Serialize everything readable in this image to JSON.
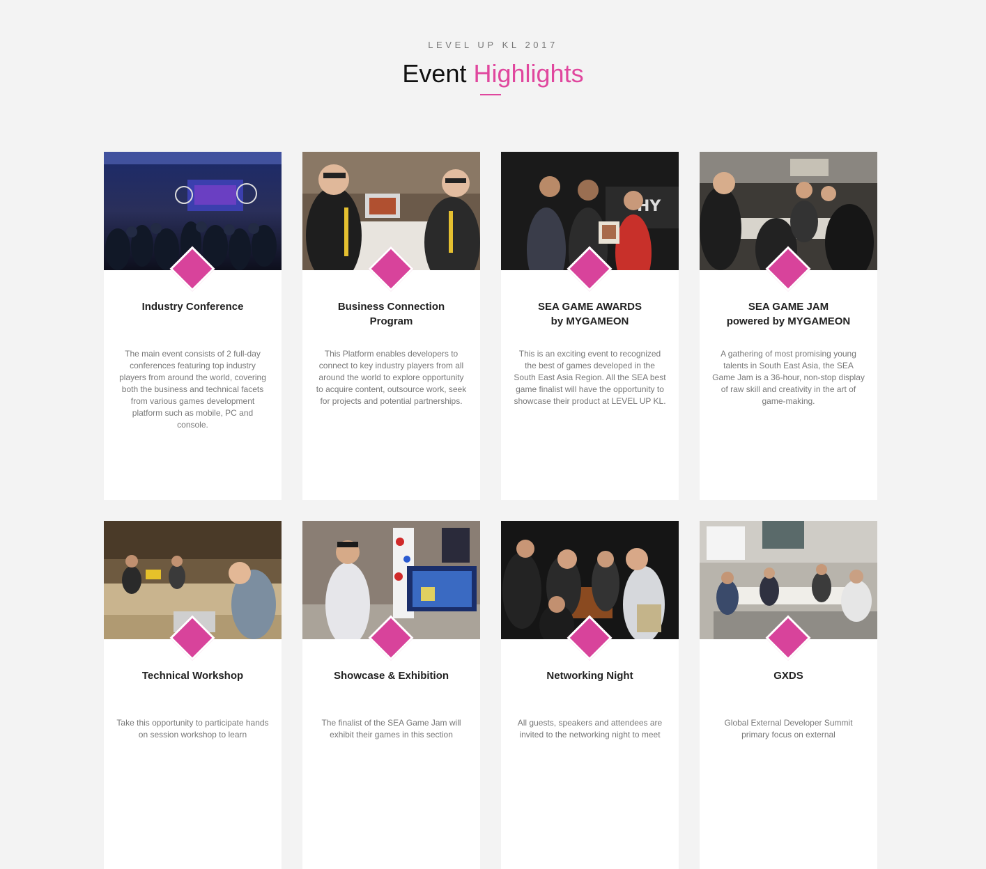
{
  "header": {
    "eyebrow": "LEVEL UP KL 2017",
    "title_part1": "Event",
    "title_part2": "Highlights"
  },
  "colors": {
    "accent": "#e0479e",
    "diamond": "#d8439b",
    "background": "#f3f3f3"
  },
  "cards": [
    {
      "title_line1": "Industry Conference",
      "title_line2": "",
      "description": "The main event consists of 2 full-day conferences featuring top industry players from around the world, covering both the business and technical facets from various games development platform such as mobile, PC and console.",
      "photo": "conference-hall-photo"
    },
    {
      "title_line1": "Business Connection",
      "title_line2": "Program",
      "description": "This Platform enables developers to connect to key industry players from all around the world to explore opportunity to acquire content, outsource work, seek for projects and potential partnerships.",
      "photo": "business-meeting-photo"
    },
    {
      "title_line1": "SEA GAME AWARDS",
      "title_line2": "by MYGAMEON",
      "description": "This is an exciting event to recognized the best of games developed in the South East Asia Region. All the SEA best game finalist will have the opportunity to showcase their product at LEVEL UP KL.",
      "photo": "award-ceremony-photo"
    },
    {
      "title_line1": "SEA GAME JAM",
      "title_line2": "powered by MYGAMEON",
      "description": "A gathering of most promising young talents in South East Asia, the SEA Game Jam is a 36-hour, non-stop display of raw skill and creativity in the art of game-making.",
      "photo": "game-jam-photo"
    },
    {
      "title_line1": "Technical Workshop",
      "title_line2": "",
      "description": "Take this opportunity to participate hands on session workshop to learn",
      "photo": "workshop-photo"
    },
    {
      "title_line1": "Showcase & Exhibition",
      "title_line2": "",
      "description": "The finalist of the SEA Game Jam will exhibit their games in this section",
      "photo": "exhibition-photo"
    },
    {
      "title_line1": "Networking Night",
      "title_line2": "",
      "description": "All guests, speakers and attendees are invited to the networking night to meet",
      "photo": "networking-party-photo"
    },
    {
      "title_line1": "GXDS",
      "title_line2": "",
      "description": "Global External Developer Summit primary focus on external",
      "photo": "summit-room-photo"
    }
  ]
}
